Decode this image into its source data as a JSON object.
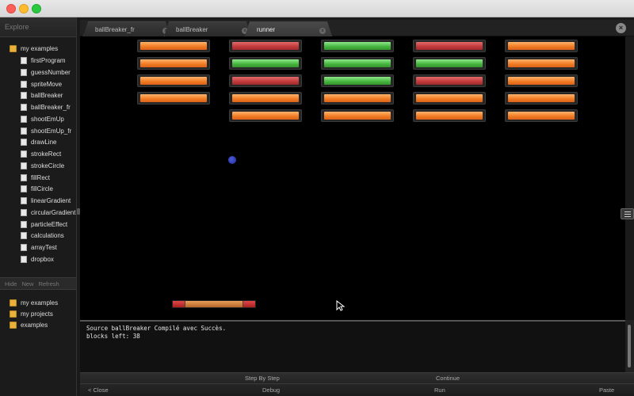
{
  "sidebar": {
    "header": "Explore",
    "root": "my examples",
    "items": [
      {
        "label": "firstProgram"
      },
      {
        "label": "guessNumber"
      },
      {
        "label": "spriteMove"
      },
      {
        "label": "ballBreaker"
      },
      {
        "label": "ballBreaker_fr"
      },
      {
        "label": "shootEmUp"
      },
      {
        "label": "shootEmUp_fr"
      },
      {
        "label": "drawLine"
      },
      {
        "label": "strokeRect"
      },
      {
        "label": "strokeCircle"
      },
      {
        "label": "fillRect"
      },
      {
        "label": "fillCircle"
      },
      {
        "label": "linearGradient"
      },
      {
        "label": "circularGradient"
      },
      {
        "label": "particleEffect"
      },
      {
        "label": "calculations"
      },
      {
        "label": "arrayTest"
      },
      {
        "label": "dropbox"
      }
    ],
    "actions": {
      "hide": "Hide",
      "new": "New",
      "refresh": "Refresh"
    },
    "projects": [
      {
        "label": "my examples"
      },
      {
        "label": "my projects"
      },
      {
        "label": "examples"
      }
    ]
  },
  "tabs": [
    {
      "label": "ballBreaker_fr",
      "close": "x"
    },
    {
      "label": "ballBreaker",
      "close": "x"
    },
    {
      "label": "runner",
      "close": "x"
    }
  ],
  "panel_close": "×",
  "game": {
    "brick_colors": {
      "o": "#f07a22",
      "r": "#c0393b",
      "g": "#45b43e"
    },
    "bricks": [
      [
        "o",
        "o",
        "o",
        "o",
        null
      ],
      [
        "r",
        "g",
        "r",
        "o",
        "o"
      ],
      [
        "g",
        "g",
        "g",
        "o",
        "o"
      ],
      [
        "r",
        "g",
        "r",
        "o",
        "o"
      ],
      [
        "o",
        "o",
        "o",
        "o",
        "o"
      ]
    ],
    "ball_color": "#2a35b5",
    "paddle_colors": {
      "ends": "#c02a2a",
      "middle": "#d98a46"
    }
  },
  "console": {
    "lines": [
      "Source ballBreaker Compilé avec Succès.",
      "blocks left: 38"
    ]
  },
  "debug_bar": {
    "step": "Step By Step",
    "continue": "Continue"
  },
  "main_bar": {
    "close": "< Close",
    "debug": "Debug",
    "run": "Run",
    "paste": "Paste"
  }
}
